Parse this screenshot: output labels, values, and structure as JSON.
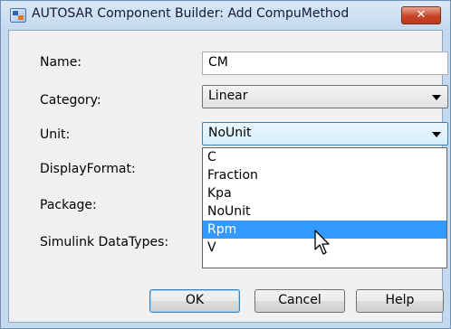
{
  "window": {
    "title": "AUTOSAR Component Builder: Add CompuMethod",
    "close_label": "✕"
  },
  "form": {
    "name_label": "Name:",
    "name_value": "CM",
    "category_label": "Category:",
    "category_value": "Linear",
    "unit_label": "Unit:",
    "unit_value": "NoUnit",
    "displayformat_label": "DisplayFormat:",
    "package_label": "Package:",
    "datatypes_label": "Simulink DataTypes:"
  },
  "unit_dropdown": {
    "options": [
      "C",
      "Fraction",
      "Kpa",
      "NoUnit",
      "Rpm",
      "V"
    ],
    "highlighted": "Rpm"
  },
  "buttons": {
    "ok": "OK",
    "cancel": "Cancel",
    "help": "Help"
  },
  "colors": {
    "highlight": "#3399ff",
    "window_frame": "#c5d9ee"
  }
}
